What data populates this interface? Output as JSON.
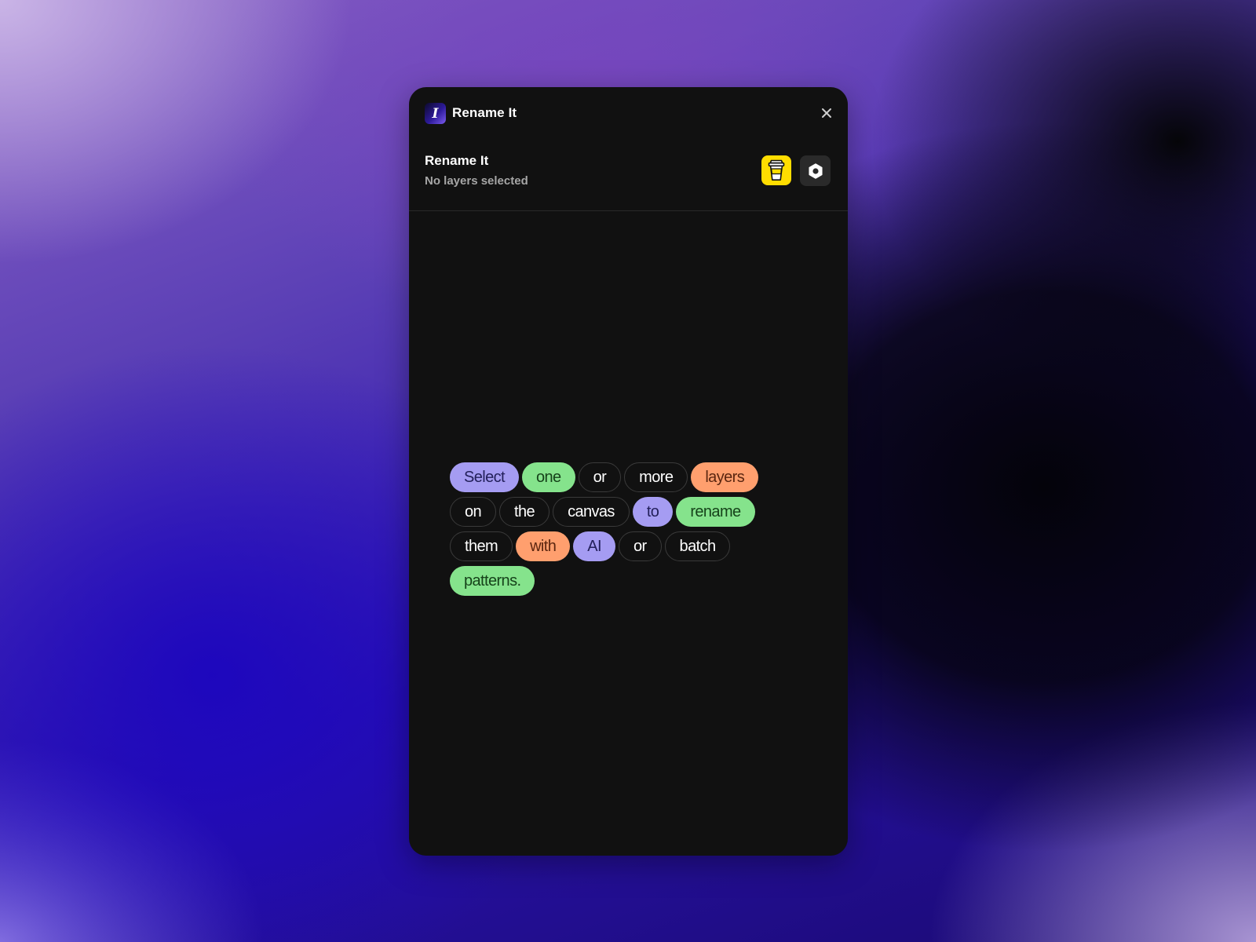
{
  "window": {
    "title": "Rename It",
    "app_icon_glyph": "I",
    "icons": {
      "app": "rename-it-logo-icon",
      "close": "close-icon"
    }
  },
  "header": {
    "title": "Rename It",
    "subtitle": "No layers selected",
    "buttons": {
      "coffee": {
        "icon": "coffee-cup-icon",
        "color": "#ffdd00"
      },
      "settings": {
        "icon": "hexagon-settings-icon",
        "color": "#2a2a2a"
      }
    }
  },
  "empty_state": {
    "words": [
      {
        "text": "Select",
        "style": "purple"
      },
      {
        "text": "one",
        "style": "green"
      },
      {
        "text": "or",
        "style": "outline"
      },
      {
        "text": "more",
        "style": "outline"
      },
      {
        "text": "layers",
        "style": "orange"
      },
      {
        "text": "on",
        "style": "outline"
      },
      {
        "text": "the",
        "style": "outline"
      },
      {
        "text": "canvas",
        "style": "outline"
      },
      {
        "text": "to",
        "style": "purple"
      },
      {
        "text": "rename",
        "style": "green"
      },
      {
        "text": "them",
        "style": "outline"
      },
      {
        "text": "with",
        "style": "orange"
      },
      {
        "text": "AI",
        "style": "purple"
      },
      {
        "text": "or",
        "style": "outline"
      },
      {
        "text": "batch",
        "style": "outline"
      },
      {
        "text": "patterns.",
        "style": "green"
      }
    ]
  },
  "colors": {
    "panel_background": "#111111",
    "pill_purple": "#a59cf2",
    "pill_green": "#85e38c",
    "pill_orange": "#ff9f6e",
    "pill_outline": "#3a3a3a"
  }
}
